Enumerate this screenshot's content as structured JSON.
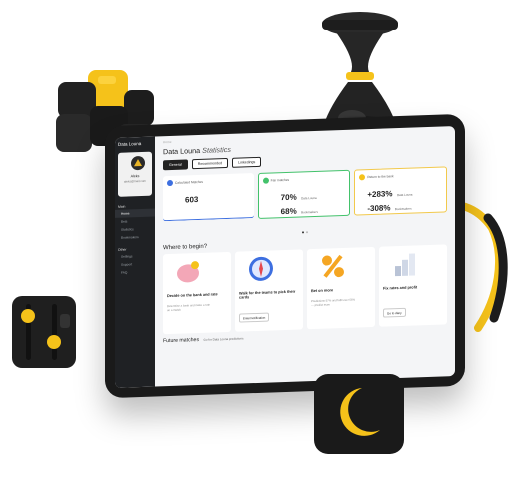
{
  "app": {
    "brand": "Data Louna"
  },
  "sidebar": {
    "user_name": "Aleks",
    "user_mail": "aleks@mail.com",
    "section_main": "Main",
    "items_main": [
      "Home",
      "Bets",
      "Statistics",
      "Bookmakers"
    ],
    "section_other": "Other",
    "items_other": [
      "Settings",
      "Support",
      "FAQ"
    ]
  },
  "header": {
    "breadcrumb": "Home",
    "title_main": "Data Louna",
    "title_accent": "Statistics"
  },
  "tabs": [
    {
      "label": "General"
    },
    {
      "label": "Recommended"
    },
    {
      "label": "Linkedings"
    }
  ],
  "stats": [
    {
      "label": "Calculated Matches",
      "value": "603"
    },
    {
      "label": "Fair matches",
      "value1": "70%",
      "cap1": "Data Louna",
      "value2": "68%",
      "cap2": "Bookmakers"
    },
    {
      "label": "Return to the bank",
      "value1": "+283%",
      "cap1": "Data Louna",
      "value2": "-308%",
      "cap2": "Bookmakers"
    }
  ],
  "where": {
    "title": "Where to begin?"
  },
  "cards": [
    {
      "title": "Decide on the bank and rate",
      "desc": "Determine a bank and make a rate on a match",
      "button": ""
    },
    {
      "title": "Walk for the teams to pick their cards",
      "desc": "",
      "button": "Enter/notification"
    },
    {
      "title": "Bet on more",
      "desc": "Predictions 57% and fulfil over 55% — predict more",
      "button": ""
    },
    {
      "title": "Fix rates and profit",
      "desc": "",
      "button": "Go to diary"
    }
  ],
  "future": {
    "title": "Future matches",
    "note": "Go for Data Louna predictions"
  },
  "colors": {
    "accent_yellow": "#f5c21a",
    "dark": "#1a1a1a",
    "blue": "#3d6fe0",
    "green": "#43c26b"
  }
}
